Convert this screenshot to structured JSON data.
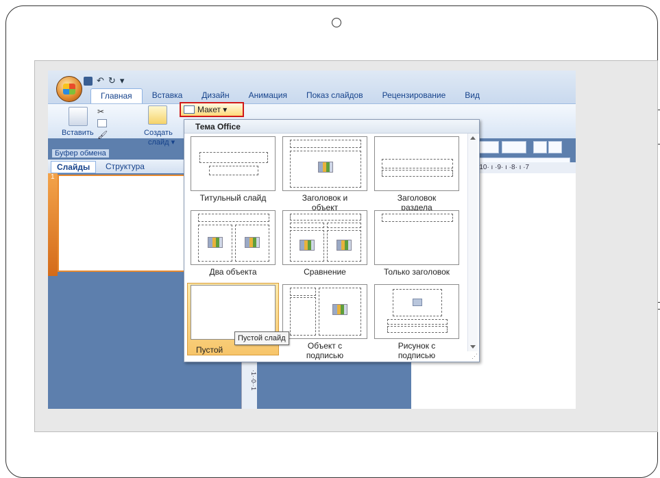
{
  "qat": {
    "undo_symbol": "↶",
    "redo_symbol": "↻",
    "more_symbol": "▾"
  },
  "tabs": [
    "Главная",
    "Вставка",
    "Дизайн",
    "Анимация",
    "Показ слайдов",
    "Рецензирование",
    "Вид"
  ],
  "ribbon": {
    "paste_label": "Вставить",
    "clipboard_group": "Буфер обмена",
    "new_slide_label": "Создать",
    "new_slide_label2": "слайд ▾",
    "layout_button": "Макет ▾",
    "ruler_text": "·10· ı ·9· ı ·8· ı ·7"
  },
  "panel_tabs": {
    "slides": "Слайды",
    "outline": "Структура"
  },
  "slide_number": "1",
  "dropdown": {
    "header": "Тема Office",
    "layouts": [
      {
        "label1": "Титульный слайд",
        "label2": ""
      },
      {
        "label1": "Заголовок и",
        "label2": "объект"
      },
      {
        "label1": "Заголовок",
        "label2": "раздела"
      },
      {
        "label1": "Два объекта",
        "label2": ""
      },
      {
        "label1": "Сравнение",
        "label2": ""
      },
      {
        "label1": "Только заголовок",
        "label2": ""
      },
      {
        "label1": "Пустой",
        "label2": ""
      },
      {
        "label1": "Объект с",
        "label2": "подписью"
      },
      {
        "label1": "Рисунок с",
        "label2": "подписью"
      }
    ],
    "tooltip": "Пустой слайд"
  },
  "colors": {
    "accent": "#d01818",
    "ribbon_text": "#15428b",
    "selected_item": "#f7c56a"
  }
}
